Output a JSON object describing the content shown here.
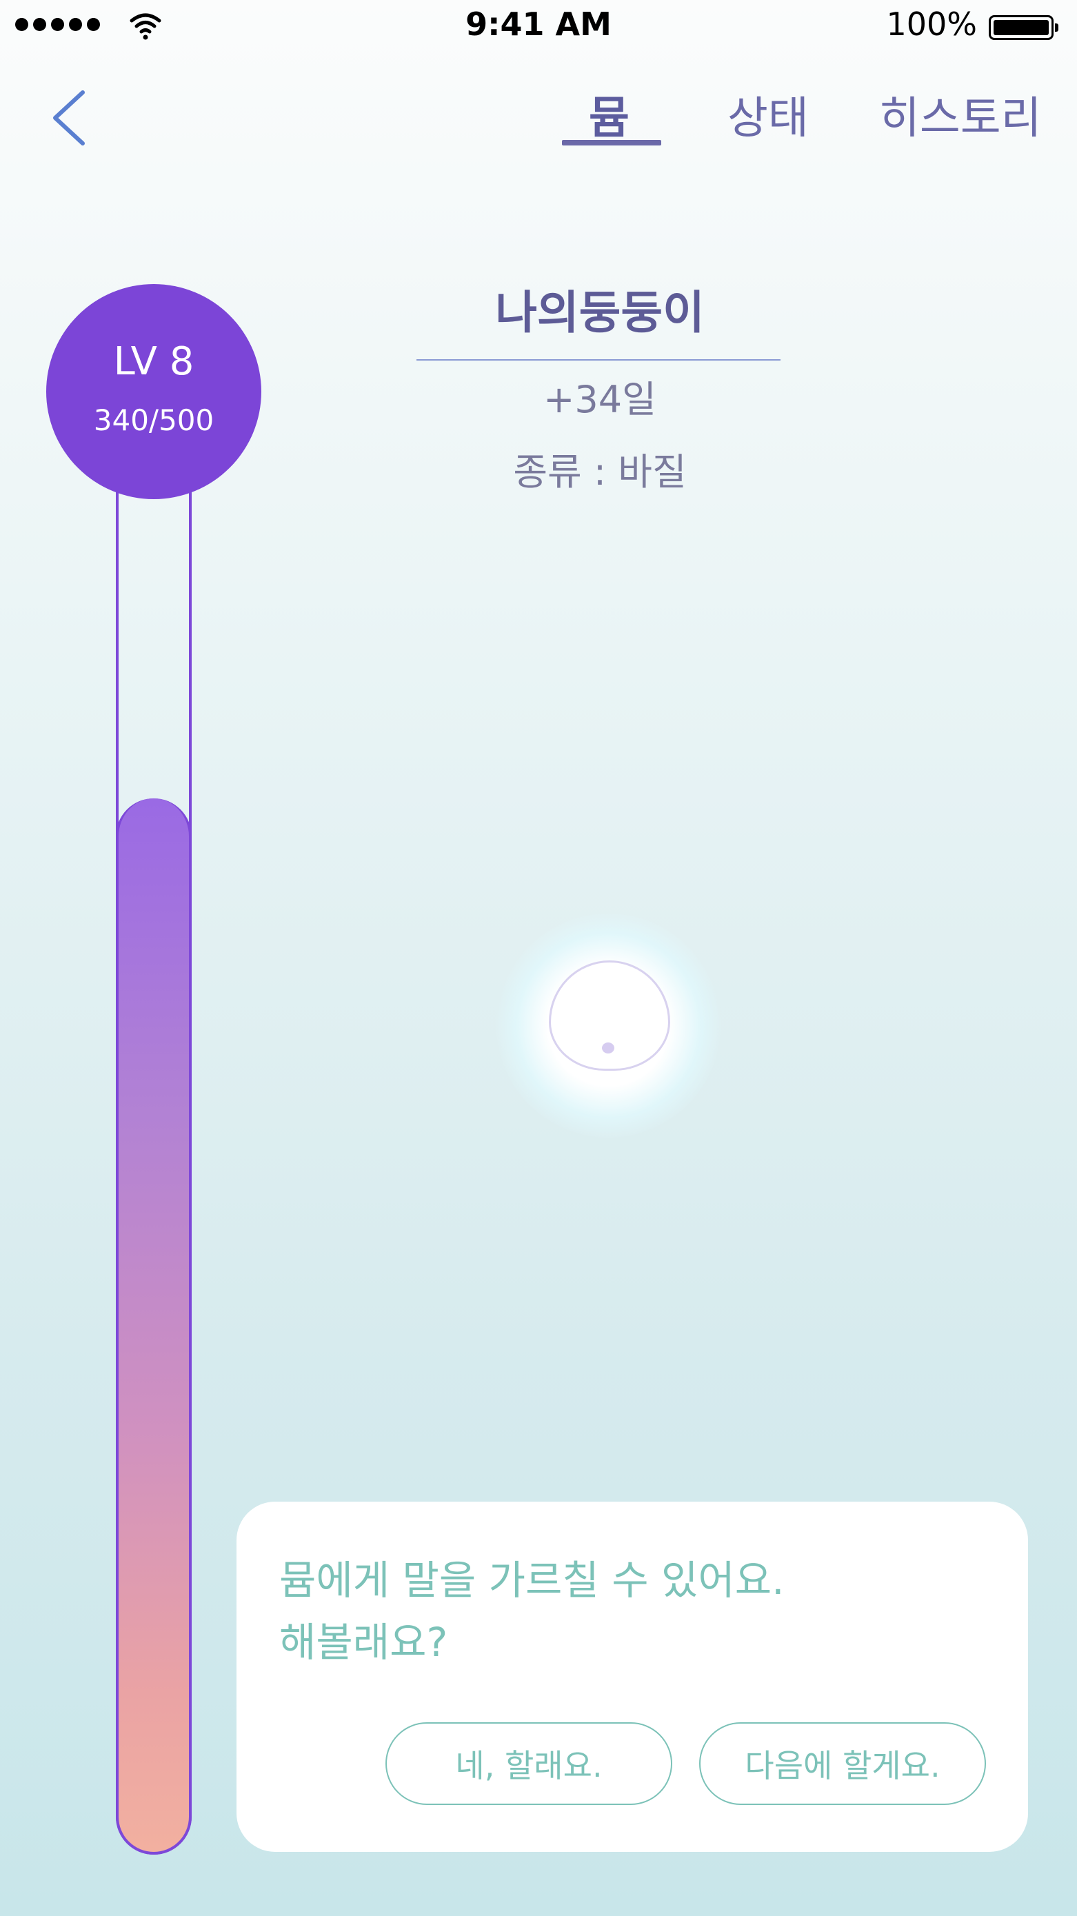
{
  "status_bar": {
    "time": "9:41 AM",
    "battery_percent": "100%",
    "icons": [
      "signal-dots-icon",
      "wifi-icon",
      "battery-icon"
    ]
  },
  "nav": {
    "back_icon": "chevron-left-icon",
    "tabs": [
      {
        "label": "뮴",
        "active": true
      },
      {
        "label": "상태",
        "active": false
      },
      {
        "label": "히스토리",
        "active": false
      }
    ]
  },
  "pet": {
    "name": "나의둥둥이",
    "days": "+34일",
    "kind": "종류 : 바질"
  },
  "level": {
    "label": "LV 8",
    "progress_text": "340/500",
    "current": 340,
    "max": 500
  },
  "dialog": {
    "message_line1": "뮴에게 말을 가르칠 수 있어요.",
    "message_line2": "해볼래요?",
    "yes_button": "네, 할래요.",
    "later_button": "다음에 할게요."
  },
  "colors": {
    "accent_purple": "#7c45d7",
    "tab_text": "#6a6aa8",
    "dialog_teal": "#7cc2b8"
  }
}
